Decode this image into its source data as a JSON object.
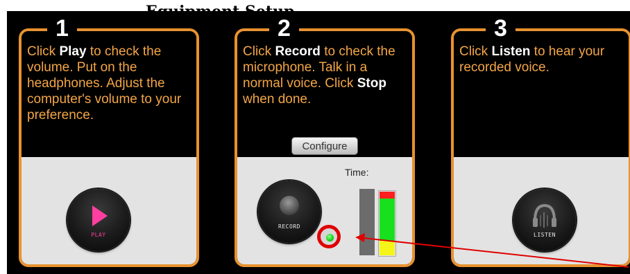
{
  "header": {
    "title": "Equipment Setup"
  },
  "steps": [
    {
      "number": "1",
      "text_parts": [
        "Click ",
        "Play",
        " to check the volume. Put on the headphones. Adjust the computer's volume to your preference."
      ],
      "button_label": "PLAY"
    },
    {
      "number": "2",
      "text_parts": [
        "Click ",
        "Record",
        " to check the microphone. Talk in a normal voice. Click ",
        "Stop",
        " when done."
      ],
      "configure_label": "Configure",
      "time_label": "Time:",
      "button_label": "RECORD"
    },
    {
      "number": "3",
      "text_parts": [
        "Click ",
        "Listen",
        " to hear your recorded voice."
      ],
      "button_label": "LISTEN"
    }
  ],
  "colors": {
    "panel_border": "#e8922f",
    "instruction_text": "#f4a646",
    "play_accent": "#ff3fa0",
    "annotation_red": "#e00000",
    "led_green": "#18d018"
  },
  "icons": {
    "play": "play-triangle-icon",
    "record": "record-dot-icon",
    "listen": "headphones-icon"
  }
}
